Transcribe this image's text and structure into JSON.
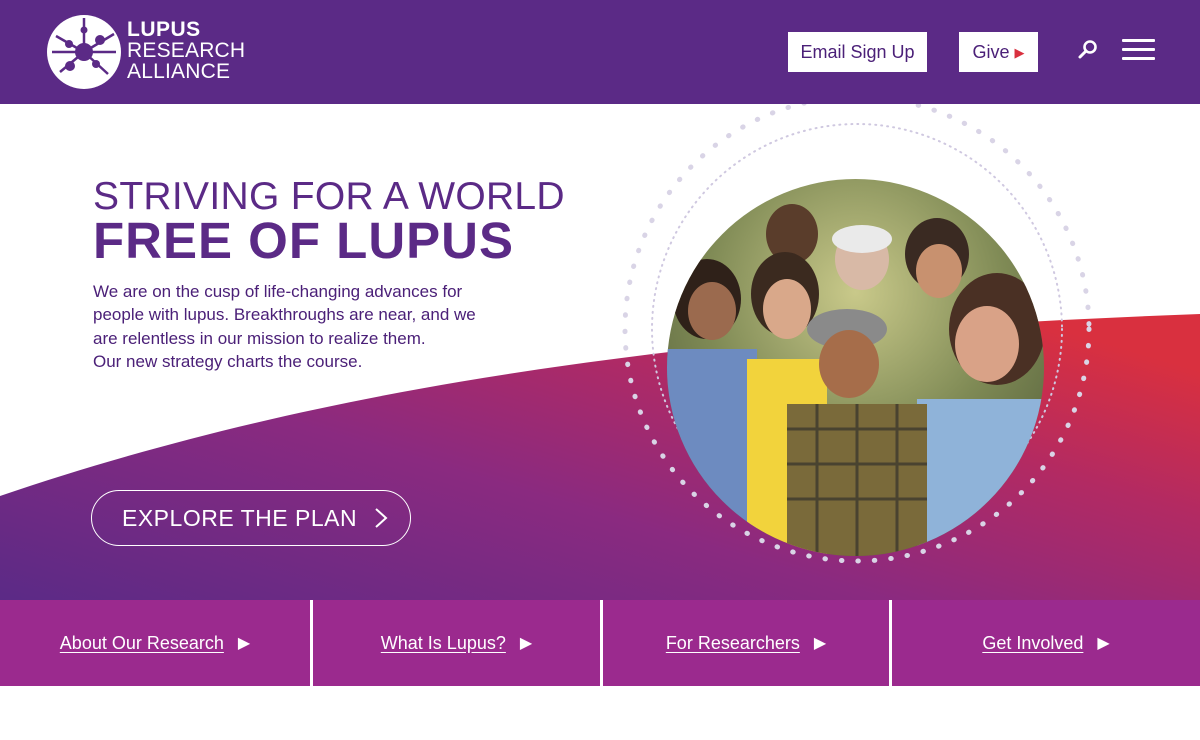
{
  "header": {
    "logo": {
      "line1": "LUPUS",
      "line2": "RESEARCH",
      "line3": "ALLIANCE"
    },
    "email_signup_label": "Email Sign Up",
    "give_label": "Give",
    "icons": {
      "search": "search-icon",
      "menu": "hamburger-menu-icon",
      "give_arrow": "play-arrow-icon"
    }
  },
  "hero": {
    "headline_line1": "STRIVING FOR A WORLD",
    "headline_line2": "FREE OF LUPUS",
    "body_lines": [
      "We are on the cusp of life-changing advances for",
      "people with lupus. Breakthroughs are near, and we",
      "are relentless in our mission to realize them.",
      "Our new strategy charts the course."
    ],
    "cta_label": "EXPLORE THE PLAN"
  },
  "nav_tiles": [
    {
      "label": "About Our Research"
    },
    {
      "label": "What Is Lupus?"
    },
    {
      "label": "For Researchers"
    },
    {
      "label": "Get Involved"
    }
  ],
  "colors": {
    "brand_purple": "#5b2a86",
    "tile_magenta": "#9b2a8e",
    "accent_red": "#d9303f"
  }
}
